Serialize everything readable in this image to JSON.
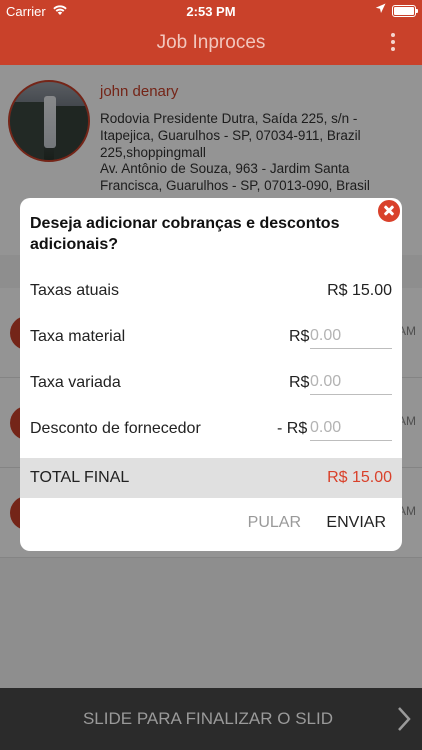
{
  "status_bar": {
    "carrier": "Carrier",
    "time": "2:53 PM"
  },
  "nav": {
    "title": "Job Inproces"
  },
  "profile": {
    "name": "john denary",
    "address_1": "Rodovia Presidente Dutra, Saída 225, s/n - Itapejica, Guarulhos - SP, 07034-911, Brazil 225,shoppingmall",
    "address_2": "Av. Antônio de Souza,  963 - Jardim Santa Francisca,  Guarulhos - SP,  07013-090,  Brasil"
  },
  "background_rows": [
    {
      "time": "AM"
    },
    {
      "time": "AM"
    },
    {
      "time": "AM"
    }
  ],
  "dialog": {
    "title": "Deseja adicionar cobranças e descontos adicionais?",
    "current_fees_label": "Taxas atuais",
    "current_fees_value": "R$ 15.00",
    "material_fee_label": "Taxa material",
    "material_fee_prefix": "R$",
    "material_fee_placeholder": "0.00",
    "variable_fee_label": "Taxa variada",
    "variable_fee_prefix": "R$",
    "variable_fee_placeholder": "0.00",
    "supplier_discount_label": "Desconto de fornecedor",
    "supplier_discount_prefix": "- R$",
    "supplier_discount_placeholder": "0.00",
    "total_label": "TOTAL FINAL",
    "total_value": "R$ 15.00",
    "skip_label": "PULAR",
    "send_label": "ENVIAR"
  },
  "slider": {
    "label": "SLIDE PARA FINALIZAR O SLID"
  },
  "colors": {
    "brand": "#c9412a",
    "close": "#d9412b",
    "total_value": "#d9412b",
    "overlay": "rgba(0,0,0,0.42)"
  },
  "icons": {
    "wifi": "wifi-icon",
    "location": "location-arrow-icon",
    "battery": "battery-icon",
    "more": "more-vertical-icon",
    "close": "close-icon",
    "chevron": "chevron-right-icon"
  }
}
